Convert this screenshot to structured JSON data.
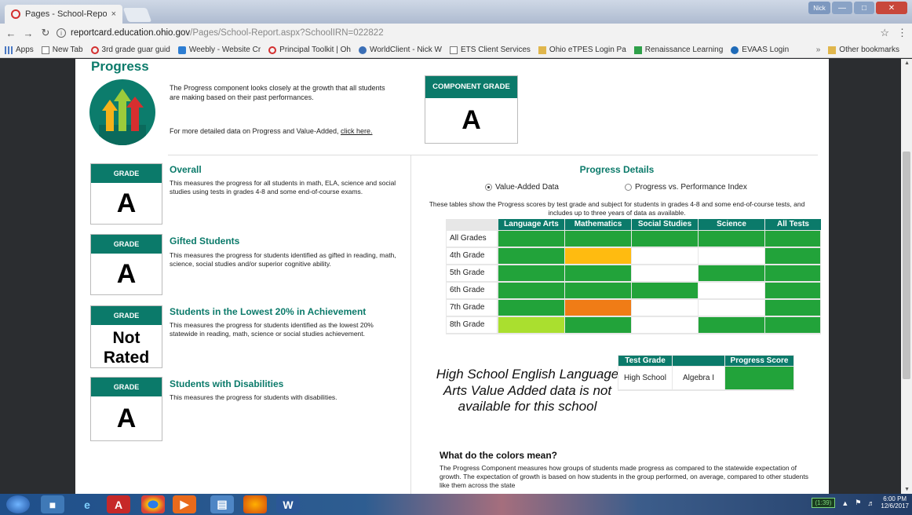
{
  "browser": {
    "tab_title": "Pages - School-Report",
    "tab_close": "×",
    "user_label": "Nick",
    "url_host": "reportcard.education.ohio.gov",
    "url_path": "/Pages/School-Report.aspx?SchoolIRN=022822",
    "bookmarks": [
      {
        "label": "Apps",
        "icon": "apps-icon"
      },
      {
        "label": "New Tab",
        "icon": "page-icon"
      },
      {
        "label": "3rd grade guar guid",
        "icon": "opera-icon"
      },
      {
        "label": "Weebly - Website Cr",
        "icon": "weebly-icon"
      },
      {
        "label": "Principal Toolkit | Oh",
        "icon": "opera-icon"
      },
      {
        "label": "WorldClient - Nick W",
        "icon": "globe-icon"
      },
      {
        "label": "ETS Client Services",
        "icon": "page-icon"
      },
      {
        "label": "Ohio eTPES Login Pa",
        "icon": "folder-icon"
      },
      {
        "label": "Renaissance Learning",
        "icon": "renaissance-icon"
      },
      {
        "label": "EVAAS Login",
        "icon": "evaas-icon"
      }
    ],
    "bookmarks_overflow": "»",
    "other_bookmarks": "Other bookmarks"
  },
  "progress": {
    "title": "Progress",
    "description": "The Progress component looks closely at the growth that all students are making based on their past performances.",
    "more_text": "For more detailed data on Progress and Value-Added,",
    "more_link": "click here.",
    "component_grade_label": "COMPONENT GRADE",
    "component_grade": "A"
  },
  "grades": [
    {
      "label": "GRADE",
      "value": "A",
      "title": "Overall",
      "desc": "This measures the progress for all students in math, ELA, science and social studies using tests in grades 4-8 and some end-of-course exams."
    },
    {
      "label": "GRADE",
      "value": "A",
      "title": "Gifted Students",
      "desc": "This measures the progress for students identified as gifted in reading, math, science, social studies and/or superior cognitive ability."
    },
    {
      "label": "GRADE",
      "value_line1": "Not",
      "value_line2": "Rated",
      "title": "Students in the Lowest 20% in Achievement",
      "desc": "This measures the progress for students identified as the lowest 20% statewide in reading, math, science or social studies achievement."
    },
    {
      "label": "GRADE",
      "value": "A",
      "title": "Students with Disabilities",
      "desc": "This measures the progress for students with disabilities."
    }
  ],
  "details": {
    "title": "Progress Details",
    "radio_value_added": "Value-Added Data",
    "radio_vs_pi": "Progress vs. Performance Index",
    "note": "These tables show the Progress scores by test grade and subject for students in grades 4-8 and some end-of-course tests, and includes up to three years of data as available.",
    "columns": [
      "Language Arts",
      "Mathematics",
      "Social Studies",
      "Science",
      "All Tests"
    ],
    "rows": [
      {
        "label": "All Grades",
        "colors": [
          "#22a33a",
          "#22a33a",
          "#22a33a",
          "#22a33a",
          "#22a33a"
        ]
      },
      {
        "label": "4th Grade",
        "colors": [
          "#22a33a",
          "#ffbb10",
          "#ffffff",
          "#ffffff",
          "#22a33a"
        ]
      },
      {
        "label": "5th Grade",
        "colors": [
          "#22a33a",
          "#22a33a",
          "#ffffff",
          "#22a33a",
          "#22a33a"
        ]
      },
      {
        "label": "6th Grade",
        "colors": [
          "#22a33a",
          "#22a33a",
          "#22a33a",
          "#ffffff",
          "#22a33a"
        ]
      },
      {
        "label": "7th Grade",
        "colors": [
          "#22a33a",
          "#f07c16",
          "#ffffff",
          "#ffffff",
          "#22a33a"
        ]
      },
      {
        "label": "8th Grade",
        "colors": [
          "#aadf2f",
          "#22a33a",
          "#ffffff",
          "#22a33a",
          "#22a33a"
        ]
      }
    ]
  },
  "hs": {
    "text": "High School English Language Arts Value Added data is not available for this school",
    "col_test_grade": "Test Grade",
    "col_blank": "",
    "col_progress_score": "Progress Score",
    "row_grade": "High School",
    "row_test": "Algebra I",
    "row_color": "#22a33a"
  },
  "colors_section": {
    "title": "What do the colors mean?",
    "desc": "The Progress Component measures how groups of students made progress as compared to the statewide expectation of growth. The expectation of growth is based on how students in the group performed, on average, compared to other students like them across the state"
  },
  "taskbar": {
    "battery": "(1:39)",
    "time": "6:00 PM",
    "date": "12/6/2017"
  }
}
